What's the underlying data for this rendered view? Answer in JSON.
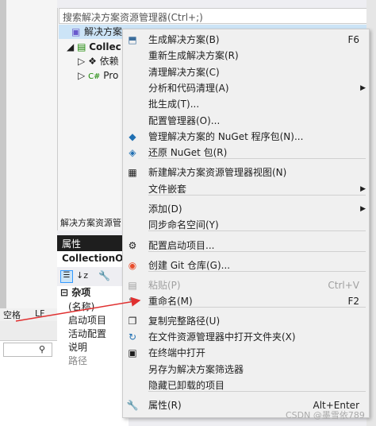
{
  "solution_explorer": {
    "search_placeholder": "搜索解决方案资源管理器(Ctrl+;)",
    "root_label": "解决方案",
    "tree_items": [
      "Collec",
      "依赖",
      "Pro"
    ],
    "tab_caption": "解决方案资源管"
  },
  "status_bar": {
    "left": "空格",
    "right": "LF"
  },
  "properties": {
    "header": "属性",
    "object": "CollectionObj",
    "category": "杂项",
    "rows": [
      "(名称)",
      "启动项目",
      "活动配置",
      "说明",
      "路径"
    ]
  },
  "context_menu": {
    "items": [
      {
        "label": "生成解决方案(B)",
        "shortcut": "F6",
        "icon": "build-icon"
      },
      {
        "label": "重新生成解决方案(R)",
        "shortcut": "",
        "icon": ""
      },
      {
        "label": "清理解决方案(C)",
        "shortcut": "",
        "icon": ""
      },
      {
        "label": "分析和代码清理(A)",
        "shortcut": "",
        "icon": "",
        "submenu": true
      },
      {
        "label": "批生成(T)...",
        "shortcut": "",
        "icon": ""
      },
      {
        "label": "配置管理器(O)...",
        "shortcut": "",
        "icon": ""
      },
      {
        "label": "管理解决方案的 NuGet 程序包(N)...",
        "shortcut": "",
        "icon": "nuget-icon"
      },
      {
        "label": "还原 NuGet 包(R)",
        "shortcut": "",
        "icon": "restore-icon"
      },
      {
        "label": "新建解决方案资源管理器视图(N)",
        "shortcut": "",
        "icon": "new-view-icon"
      },
      {
        "label": "文件嵌套",
        "shortcut": "",
        "icon": "",
        "submenu": true
      },
      {
        "label": "添加(D)",
        "shortcut": "",
        "icon": "",
        "submenu": true
      },
      {
        "label": "同步命名空间(Y)",
        "shortcut": "",
        "icon": ""
      },
      {
        "label": "配置启动项目...",
        "shortcut": "",
        "icon": "gear-icon"
      },
      {
        "label": "创建 Git 仓库(G)...",
        "shortcut": "",
        "icon": "git-icon"
      },
      {
        "label": "粘贴(P)",
        "shortcut": "Ctrl+V",
        "icon": "paste-icon",
        "disabled": true
      },
      {
        "label": "重命名(M)",
        "shortcut": "F2",
        "icon": "rename-icon"
      },
      {
        "label": "复制完整路径(U)",
        "shortcut": "",
        "icon": "copy-icon"
      },
      {
        "label": "在文件资源管理器中打开文件夹(X)",
        "shortcut": "",
        "icon": "open-folder-icon"
      },
      {
        "label": "在终端中打开",
        "shortcut": "",
        "icon": "terminal-icon"
      },
      {
        "label": "另存为解决方案筛选器",
        "shortcut": "",
        "icon": ""
      },
      {
        "label": "隐藏已卸载的项目",
        "shortcut": "",
        "icon": ""
      },
      {
        "label": "属性(R)",
        "shortcut": "Alt+Enter",
        "icon": "wrench-icon"
      }
    ]
  },
  "watermark": "CSDN @墨雪依789",
  "accent_color": "#e03030"
}
